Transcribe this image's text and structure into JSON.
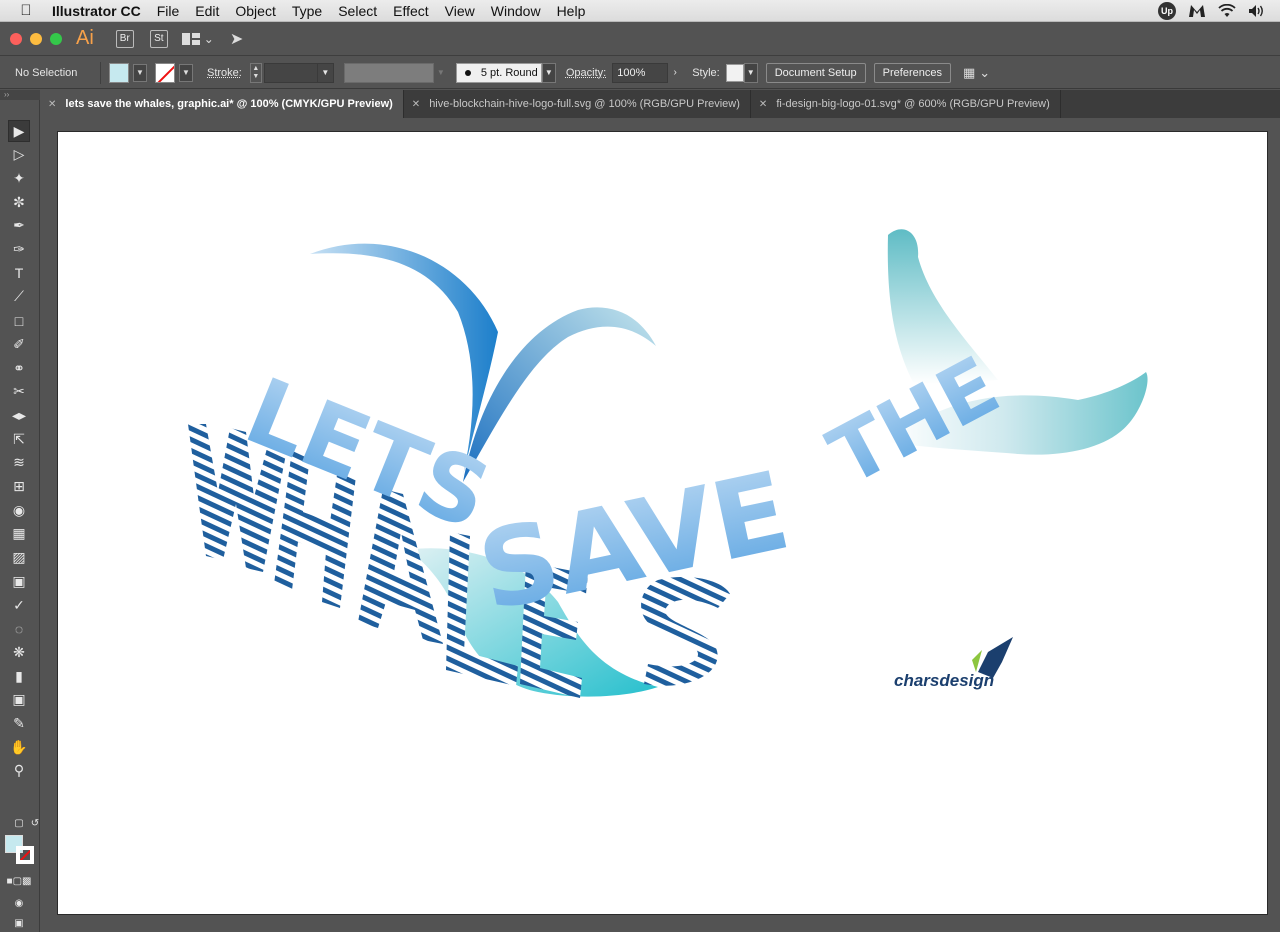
{
  "menubar": {
    "app_name": "Illustrator CC",
    "menus": [
      "File",
      "Edit",
      "Object",
      "Type",
      "Select",
      "Effect",
      "View",
      "Window",
      "Help"
    ],
    "tray_badge": "Up"
  },
  "appbar": {
    "logo": "Ai",
    "bridge": "Br",
    "stock": "St"
  },
  "controlbar": {
    "selection_status": "No Selection",
    "fill_color": "#c6e9ef",
    "stroke_label": "Stroke:",
    "stroke_weight": "",
    "brush_label": "5 pt. Round",
    "opacity_label": "Opacity:",
    "opacity_value": "100%",
    "style_label": "Style:",
    "document_setup": "Document Setup",
    "preferences": "Preferences"
  },
  "tabs": [
    {
      "label": "lets save the whales, graphic.ai* @ 100% (CMYK/GPU Preview)",
      "active": true
    },
    {
      "label": "hive-blockchain-hive-logo-full.svg @ 100% (RGB/GPU Preview)",
      "active": false
    },
    {
      "label": "fi-design-big-logo-01.svg* @ 600% (RGB/GPU Preview)",
      "active": false
    }
  ],
  "tools": [
    "selection-tool",
    "direct-selection-tool",
    "magic-wand-tool",
    "lasso-tool",
    "pen-tool",
    "curvature-tool",
    "type-tool",
    "line-segment-tool",
    "rectangle-tool",
    "paintbrush-tool",
    "shaper-tool",
    "eraser-tool",
    "reflect-tool",
    "scale-tool",
    "warp-tool",
    "free-transform-tool",
    "shape-builder-tool",
    "perspective-grid-tool",
    "mesh-tool",
    "gradient-tool",
    "eyedropper-tool",
    "blend-tool",
    "symbol-sprayer-tool",
    "column-graph-tool",
    "artboard-tool",
    "slice-tool",
    "hand-tool",
    "zoom-tool"
  ],
  "artwork": {
    "headline_top": "LETS",
    "headline_mid": "SAVE",
    "headline_end": "THE",
    "headline_bottom": "WHALES",
    "brand": "charsdesign",
    "colors": {
      "blue_light": "#a7cdf0",
      "blue_mid": "#5ea6e2",
      "stripe_blue": "#1f5f9e",
      "teal": "#00b4c4",
      "teal_light": "#7fcad3",
      "brand_navy": "#1b3f6e",
      "brand_green": "#8dc63f"
    }
  }
}
